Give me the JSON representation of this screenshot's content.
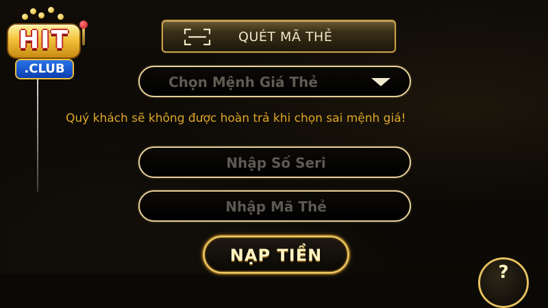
{
  "logo": {
    "brand": "HIT",
    "suffix": ".CLUB"
  },
  "scan_button": {
    "label": "QUÉT MÃ THẺ",
    "icon": "scan-icon"
  },
  "denomination": {
    "label": "Chọn Mệnh Giá Thẻ",
    "icon": "chevron-down-icon"
  },
  "warning_text": "Quý khách sẽ không được hoàn trả khi chọn sai mệnh giá!",
  "serial_field": {
    "placeholder": "Nhập Số Seri",
    "value": ""
  },
  "code_field": {
    "placeholder": "Nhập Mã Thẻ",
    "value": ""
  },
  "submit_button": {
    "label": "NẠP TIỀN"
  },
  "help_button": {
    "label": "?",
    "icon": "help-icon"
  },
  "colors": {
    "accent_gold": "#e9d29a",
    "warning": "#e0a826",
    "background": "#0b0906"
  }
}
